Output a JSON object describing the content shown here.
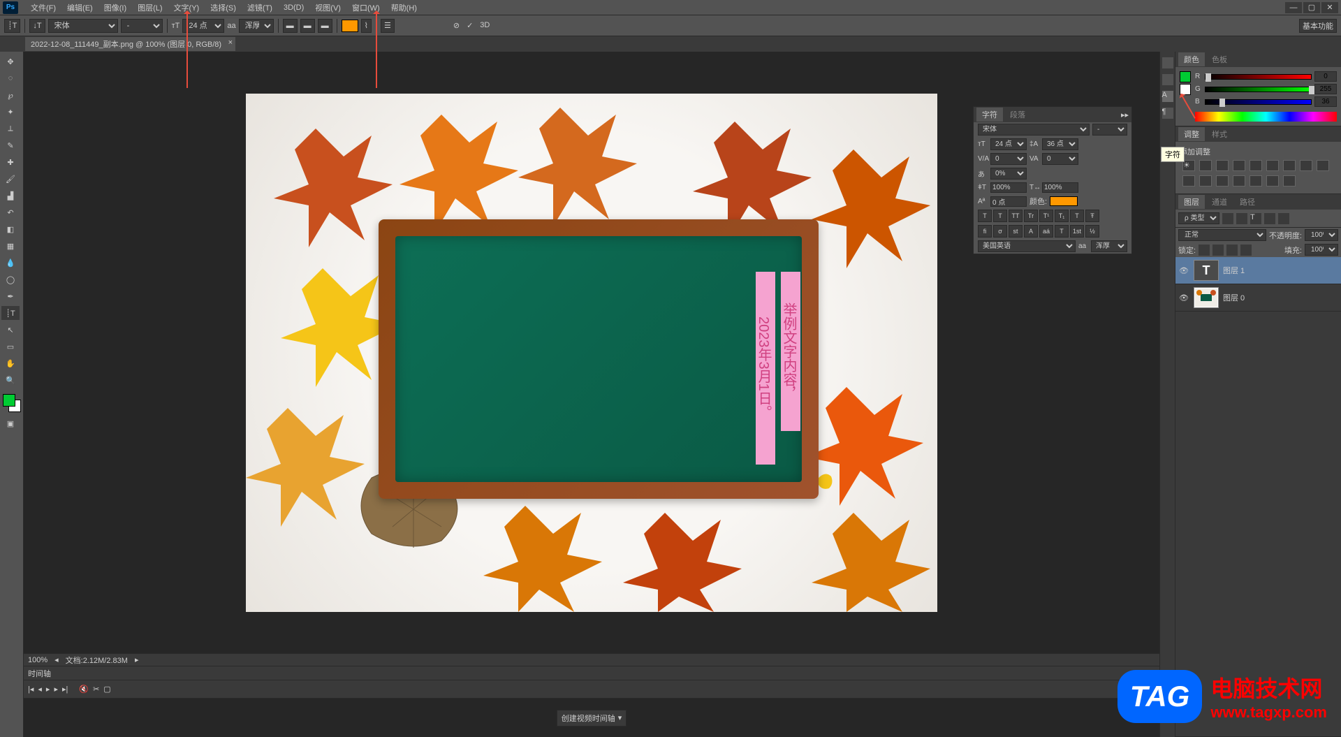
{
  "menubar": {
    "items": [
      "文件(F)",
      "编辑(E)",
      "图像(I)",
      "图层(L)",
      "文字(Y)",
      "选择(S)",
      "滤镜(T)",
      "3D(D)",
      "视图(V)",
      "窗口(W)",
      "帮助(H)"
    ]
  },
  "optionsbar": {
    "font": "宋体",
    "fontStyle": "-",
    "fontSize": "24 点",
    "aa": "浑厚",
    "workspace": "基本功能",
    "threeD": "3D"
  },
  "docTab": "2022-12-08_111449_副本.png @ 100% (图层 0, RGB/8)",
  "canvas": {
    "text1": "举例文字内容，",
    "text2": "2023年3月1日。"
  },
  "status": {
    "zoom": "100%",
    "doc": "文档:2.12M/2.83M"
  },
  "timeline": {
    "title": "时间轴",
    "button": "创建视频时间轴"
  },
  "colorPanel": {
    "tabs": [
      "颜色",
      "色板"
    ],
    "r": "0",
    "g": "255",
    "b": "36"
  },
  "adjustPanel": {
    "tabs": [
      "调整",
      "样式"
    ],
    "label": "添加调整"
  },
  "charPanel": {
    "tabs": [
      "字符",
      "段落"
    ],
    "font": "宋体",
    "style": "-",
    "size": "24 点",
    "leading": "36 点",
    "tracking": "0",
    "kerning": "0",
    "scale": "0%",
    "vscale": "100%",
    "hscale": "100%",
    "baseline": "0 点",
    "colorLabel": "颜色:",
    "lang": "美国英语",
    "aa": "浑厚",
    "styleBtns": [
      "T",
      "T",
      "TT",
      "Tr",
      "T¹",
      "T₁",
      "T",
      "Ŧ"
    ],
    "otBtns": [
      "fi",
      "σ",
      "st",
      "A",
      "aá",
      "T",
      "1st",
      "½"
    ]
  },
  "tooltip": "字符",
  "layersPanel": {
    "tabs": [
      "图层",
      "通道",
      "路径"
    ],
    "kind": "ρ 类型",
    "blend": "正常",
    "opacityLabel": "不透明度:",
    "opacity": "100%",
    "lockLabel": "锁定:",
    "fillLabel": "填充:",
    "fill": "100%",
    "layers": [
      {
        "name": "图层 1",
        "type": "text",
        "active": true
      },
      {
        "name": "图层 0",
        "type": "image",
        "active": false
      }
    ]
  },
  "watermark": {
    "tag": "TAG",
    "cn": "电脑技术网",
    "en": "www.tagxp.com"
  }
}
